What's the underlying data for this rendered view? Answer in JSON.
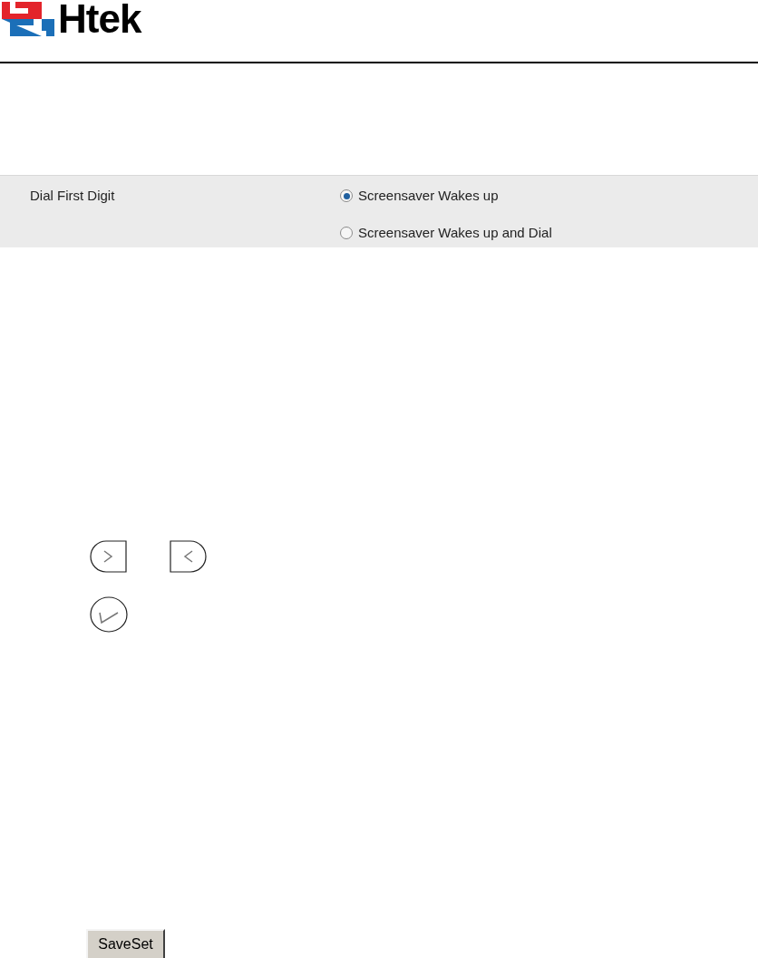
{
  "logo": {
    "text": "Htek"
  },
  "setting": {
    "label": "Dial First Digit",
    "options": [
      {
        "label": "Screensaver Wakes up",
        "selected": true
      },
      {
        "label": "Screensaver Wakes up and Dial",
        "selected": false
      }
    ]
  },
  "save_button": {
    "label": "SaveSet"
  }
}
